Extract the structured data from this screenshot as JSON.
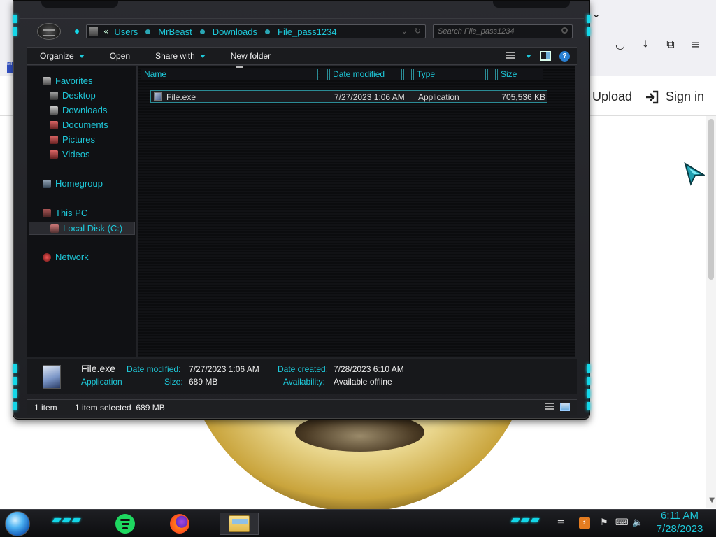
{
  "browser": {
    "upload_label": "Upload",
    "signin_label": "Sign in",
    "tab_favicon_text": "Mi"
  },
  "explorer": {
    "address": {
      "crumbs": [
        "Users",
        "MrBeast",
        "Downloads",
        "File_pass1234"
      ],
      "overflow": "«"
    },
    "search": {
      "placeholder": "Search File_pass1234"
    },
    "toolbar": {
      "organize": "Organize",
      "open": "Open",
      "share_with": "Share with",
      "new_folder": "New folder"
    },
    "nav": {
      "favorites": "Favorites",
      "desktop": "Desktop",
      "downloads": "Downloads",
      "documents": "Documents",
      "pictures": "Pictures",
      "videos": "Videos",
      "homegroup": "Homegroup",
      "this_pc": "This PC",
      "local_disk": "Local Disk (C:)",
      "network": "Network"
    },
    "columns": {
      "name": "Name",
      "date_modified": "Date modified",
      "type": "Type",
      "size": "Size"
    },
    "files": [
      {
        "name": "File.exe",
        "date_modified": "7/27/2023 1:06 AM",
        "type": "Application",
        "size": "705,536 KB"
      }
    ],
    "details": {
      "file_name": "File.exe",
      "file_type": "Application",
      "date_modified_label": "Date modified:",
      "date_modified": "7/27/2023 1:06 AM",
      "size_label": "Size:",
      "size": "689 MB",
      "date_created_label": "Date created:",
      "date_created": "7/28/2023 6:10 AM",
      "availability_label": "Availability:",
      "availability": "Available offline"
    },
    "status": {
      "item_count": "1 item",
      "selection": "1 item selected  689 MB"
    }
  },
  "taskbar": {
    "clock_time": "6:11 AM",
    "clock_date": "7/28/2023"
  },
  "colors": {
    "accent": "#1ec9da",
    "window_bg": "#1f2024",
    "content_bg": "#0b0c0e"
  }
}
